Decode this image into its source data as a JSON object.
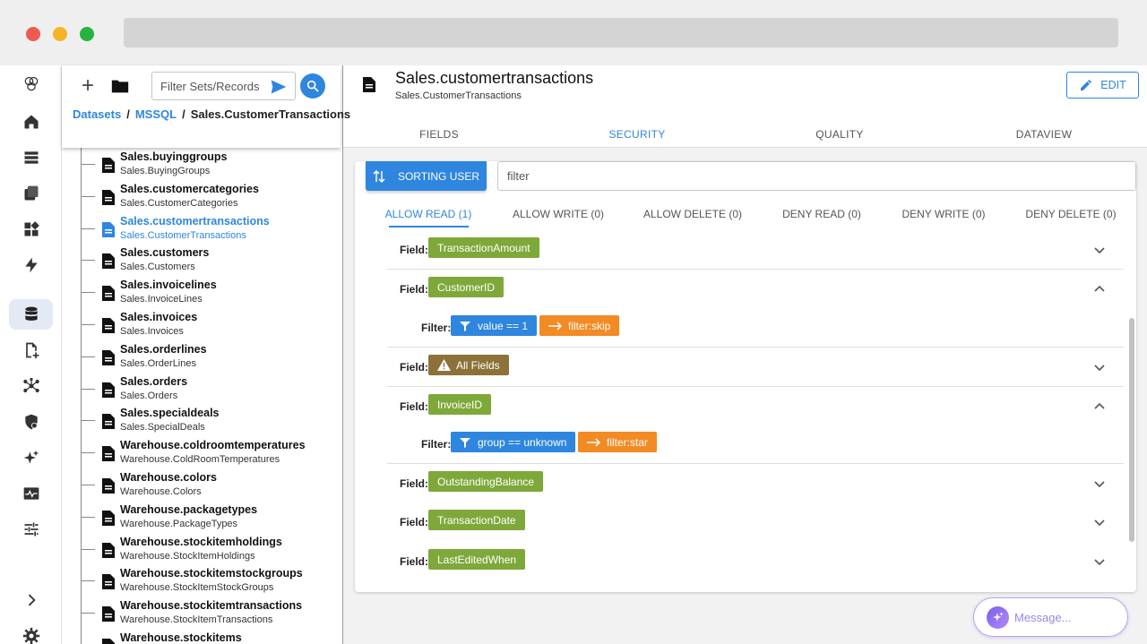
{
  "nav": {
    "filter_placeholder": "Filter Sets/Records",
    "breadcrumb": [
      "Datasets",
      "MSSQL",
      "Sales.CustomerTransactions"
    ],
    "items": [
      {
        "title": "Sales.buyinggroups",
        "sub": "Sales.BuyingGroups"
      },
      {
        "title": "Sales.customercategories",
        "sub": "Sales.CustomerCategories"
      },
      {
        "title": "Sales.customertransactions",
        "sub": "Sales.CustomerTransactions"
      },
      {
        "title": "Sales.customers",
        "sub": "Sales.Customers"
      },
      {
        "title": "Sales.invoicelines",
        "sub": "Sales.InvoiceLines"
      },
      {
        "title": "Sales.invoices",
        "sub": "Sales.Invoices"
      },
      {
        "title": "Sales.orderlines",
        "sub": "Sales.OrderLines"
      },
      {
        "title": "Sales.orders",
        "sub": "Sales.Orders"
      },
      {
        "title": "Sales.specialdeals",
        "sub": "Sales.SpecialDeals"
      },
      {
        "title": "Warehouse.coldroomtemperatures",
        "sub": "Warehouse.ColdRoomTemperatures"
      },
      {
        "title": "Warehouse.colors",
        "sub": "Warehouse.Colors"
      },
      {
        "title": "Warehouse.packagetypes",
        "sub": "Warehouse.PackageTypes"
      },
      {
        "title": "Warehouse.stockitemholdings",
        "sub": "Warehouse.StockItemHoldings"
      },
      {
        "title": "Warehouse.stockitemstockgroups",
        "sub": "Warehouse.StockItemStockGroups"
      },
      {
        "title": "Warehouse.stockitemtransactions",
        "sub": "Warehouse.StockItemTransactions"
      },
      {
        "title": "Warehouse.stockitems",
        "sub": ""
      }
    ]
  },
  "main": {
    "title": "Sales.customertransactions",
    "subtitle": "Sales.CustomerTransactions",
    "edit_label": "EDIT",
    "tabs": [
      "FIELDS",
      "SECURITY",
      "QUALITY",
      "DATAVIEW"
    ],
    "sort_label": "SORTING USER",
    "filter_placeholder": "filter",
    "perm_tabs": [
      "ALLOW READ (1)",
      "ALLOW WRITE (0)",
      "ALLOW DELETE (0)",
      "DENY READ (0)",
      "DENY WRITE (0)",
      "DENY DELETE (0)"
    ],
    "field_label": "Field:",
    "filter_label": "Filter:",
    "fields": {
      "f0": "TransactionAmount",
      "f1": "CustomerID",
      "f1_filter": "value == 1",
      "f1_action": "filter:skip",
      "f2": "All Fields",
      "f3": "InvoiceID",
      "f3_filter": "group == unknown",
      "f3_action": "filter:star",
      "f4": "OutstandingBalance",
      "f5": "TransactionDate",
      "f6": "LastEditedWhen"
    },
    "message_placeholder": "Message..."
  },
  "colors": {
    "accent": "#2e86de",
    "field_chip": "#7fa83a",
    "warning_chip": "#8c7238",
    "action_chip": "#f28b24"
  }
}
